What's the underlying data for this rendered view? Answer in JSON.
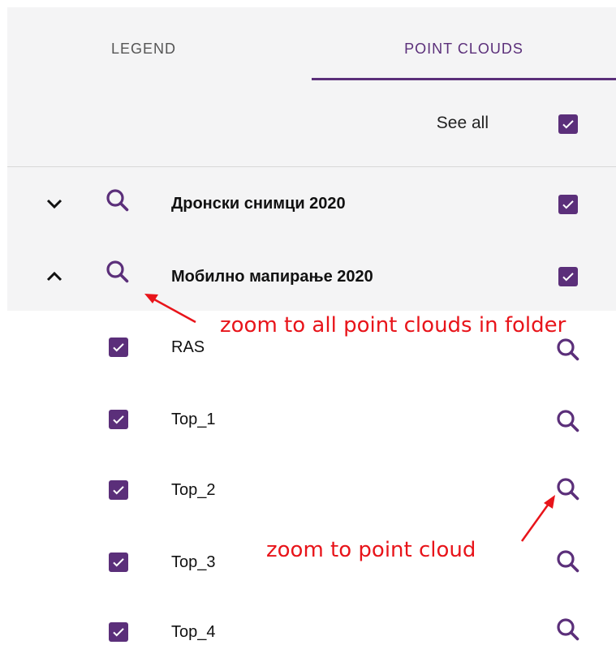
{
  "tabs": [
    {
      "label": "LEGEND",
      "active": false
    },
    {
      "label": "POINT CLOUDS",
      "active": true
    }
  ],
  "header": {
    "see_all_label": "See all",
    "see_all_checked": true
  },
  "folders": [
    {
      "label": "Дронски снимци 2020",
      "expanded": false,
      "checked": true
    },
    {
      "label": "Мобилно мапирање 2020",
      "expanded": true,
      "checked": true
    }
  ],
  "items": [
    {
      "label": "RAS",
      "checked": true
    },
    {
      "label": "Top_1",
      "checked": true
    },
    {
      "label": "Top_2",
      "checked": true
    },
    {
      "label": "Top_3",
      "checked": true
    },
    {
      "label": "Top_4",
      "checked": true
    }
  ],
  "annotations": {
    "folder_zoom": "zoom to all point clouds in folder",
    "item_zoom": "zoom to point cloud"
  },
  "colors": {
    "accent": "#5b2f7a",
    "annotation": "#e8141a",
    "panel_bg": "#f4f4f5"
  },
  "icons": {
    "zoom": "search-icon",
    "expand": "chevron-down-icon",
    "collapse": "chevron-up-icon",
    "check": "checkmark-icon"
  }
}
